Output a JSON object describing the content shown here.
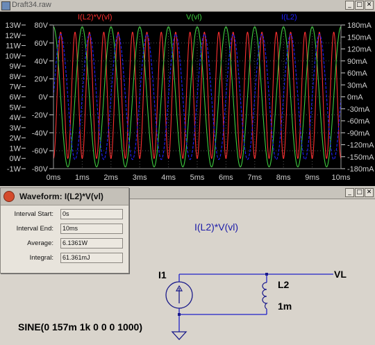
{
  "plot_window": {
    "title": "Draft34.raw",
    "traces": [
      {
        "label": "I(L2)*V(vl)",
        "color": "#ff3030"
      },
      {
        "label": "V(vl)",
        "color": "#40d040"
      },
      {
        "label": "I(L2)",
        "color": "#2020ff"
      }
    ],
    "window_buttons": [
      "_",
      "□",
      "✕"
    ]
  },
  "chart_data": {
    "type": "line",
    "x": {
      "label": "",
      "min_ms": 0,
      "max_ms": 10,
      "ticks": [
        "0ms",
        "1ms",
        "2ms",
        "3ms",
        "4ms",
        "5ms",
        "6ms",
        "7ms",
        "8ms",
        "9ms",
        "10ms"
      ]
    },
    "y_axes": {
      "power": {
        "min": -1,
        "max": 13,
        "unit": "W",
        "ticks": [
          "13W",
          "12W",
          "11W",
          "10W",
          "9W",
          "8W",
          "7W",
          "6W",
          "5W",
          "4W",
          "3W",
          "2W",
          "1W",
          "0W",
          "-1W"
        ]
      },
      "voltage": {
        "min": -80,
        "max": 80,
        "unit": "V",
        "ticks": [
          "80V",
          "60V",
          "40V",
          "20V",
          "0V",
          "-20V",
          "-40V",
          "-60V",
          "-80V"
        ]
      },
      "current": {
        "min": -180,
        "max": 180,
        "unit": "mA",
        "ticks": [
          "180mA",
          "150mA",
          "120mA",
          "90mA",
          "60mA",
          "30mA",
          "0mA",
          "-30mA",
          "-60mA",
          "-90mA",
          "-120mA",
          "-150mA",
          "-180mA"
        ]
      }
    },
    "series": [
      {
        "name": "I(L2)*V(vl)",
        "axis": "power",
        "shape": "sin^2",
        "min": 0,
        "max": 12.3,
        "frequency_khz": 1
      },
      {
        "name": "V(vl)",
        "axis": "voltage",
        "shape": "cos",
        "amplitude": 78,
        "frequency_khz": 1
      },
      {
        "name": "I(L2)",
        "axis": "current",
        "shape": "sin",
        "amplitude": 157,
        "frequency_khz": 1
      }
    ],
    "grid": true
  },
  "dialog": {
    "title": "Waveform: I(L2)*V(vl)",
    "rows": [
      {
        "label": "Interval Start:",
        "value": "0s"
      },
      {
        "label": "Interval End:",
        "value": "10ms"
      },
      {
        "label": "Average:",
        "value": "6.1361W"
      },
      {
        "label": "Integral:",
        "value": "61.361mJ"
      }
    ]
  },
  "schematic": {
    "expression": "I(L2)*V(vl)",
    "source_name": "I1",
    "source_value": "SINE(0 157m 1k 0 0 0 1000)",
    "inductor_name": "L2",
    "inductor_value": "1m",
    "net_label": "VL",
    "wire_color": "#2020c8",
    "window_buttons": [
      "_",
      "□",
      "✕"
    ]
  }
}
